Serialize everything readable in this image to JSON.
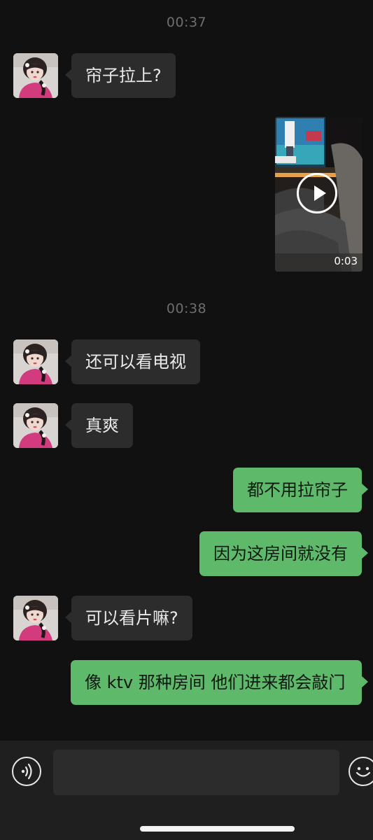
{
  "timestamps": [
    "00:37",
    "00:38"
  ],
  "messages": [
    {
      "side": "in",
      "text": "帘子拉上?"
    },
    {
      "side": "out",
      "type": "video",
      "duration": "0:03"
    },
    {
      "side": "in",
      "text": "还可以看电视"
    },
    {
      "side": "in",
      "text": "真爽"
    },
    {
      "side": "out",
      "text": "都不用拉帘子"
    },
    {
      "side": "out",
      "text": "因为这房间就没有"
    },
    {
      "side": "in",
      "text": "可以看片嘛?"
    },
    {
      "side": "out",
      "text": "像 ktv 那种房间 他们进来都会敲门"
    }
  ],
  "input": {
    "placeholder": ""
  },
  "icons": {
    "voice": "voice-icon",
    "emoji": "emoji-icon"
  },
  "colors": {
    "background": "#111111",
    "incoming_bubble": "#2c2c2c",
    "outgoing_bubble": "#5fb96b",
    "timestamp": "#6e6e6e",
    "bottom_bar": "#1f1f1f"
  }
}
